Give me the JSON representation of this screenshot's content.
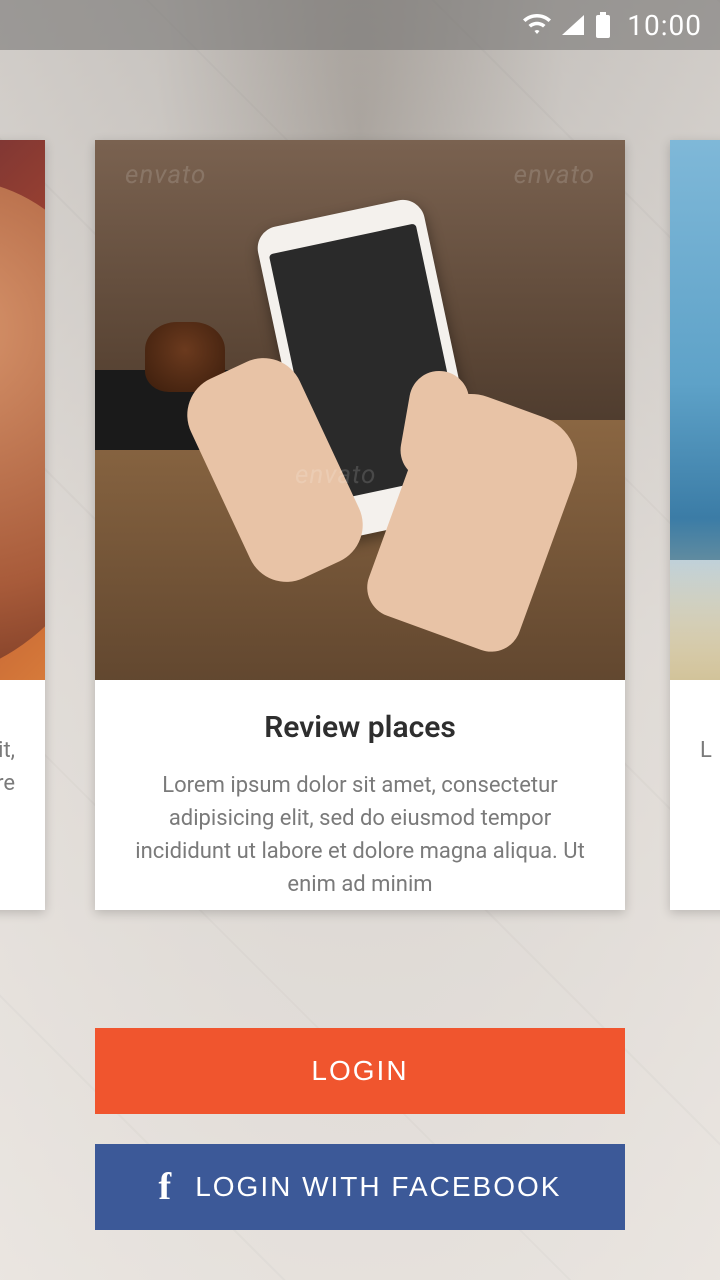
{
  "status_bar": {
    "time": "10:00"
  },
  "carousel": {
    "left_card": {
      "title": "",
      "text": "elit,\nore"
    },
    "center_card": {
      "title": "Review places",
      "text": "Lorem ipsum dolor sit amet, consectetur adipisicing elit, sed do eiusmod tempor incididunt ut labore et dolore magna aliqua. Ut enim ad minim"
    },
    "right_card": {
      "title": "",
      "text": "L"
    }
  },
  "buttons": {
    "login": "LOGIN",
    "facebook": "LOGIN WITH FACEBOOK"
  },
  "watermark": "envato",
  "colors": {
    "primary": "#f0552e",
    "facebook": "#3c5998"
  }
}
